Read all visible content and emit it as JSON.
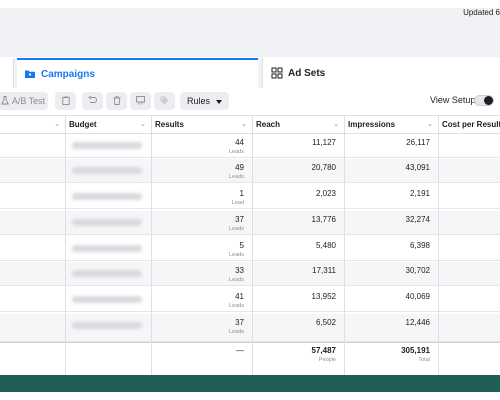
{
  "header": {
    "updated_text": "Updated 6"
  },
  "tabs": [
    {
      "label": "Campaigns",
      "icon": "folder-icon",
      "active": true
    },
    {
      "label": "Ad Sets",
      "icon": "grid-icon",
      "active": false
    }
  ],
  "toolbar": {
    "ab_test_label": "A/B Test",
    "rules_label": "Rules",
    "view_setup_label": "View Setup",
    "view_setup_on": true
  },
  "table": {
    "columns": [
      "Budget",
      "Results",
      "Reach",
      "Impressions",
      "Cost per Result"
    ],
    "rows": [
      {
        "results": "44",
        "results_sub": "Leads",
        "reach": "11,127",
        "impressions": "26,117"
      },
      {
        "results": "49",
        "results_sub": "Leads",
        "reach": "20,780",
        "impressions": "43,091"
      },
      {
        "results": "1",
        "results_sub": "Lead",
        "reach": "2,023",
        "impressions": "2,191"
      },
      {
        "results": "37",
        "results_sub": "Leads",
        "reach": "13,776",
        "impressions": "32,274"
      },
      {
        "results": "5",
        "results_sub": "Leads",
        "reach": "5,480",
        "impressions": "6,398"
      },
      {
        "results": "33",
        "results_sub": "Leads",
        "reach": "17,311",
        "impressions": "30,702"
      },
      {
        "results": "41",
        "results_sub": "Leads",
        "reach": "13,952",
        "impressions": "40,069"
      },
      {
        "results": "37",
        "results_sub": "Leads",
        "reach": "6,502",
        "impressions": "12,446"
      }
    ],
    "totals": {
      "results": "—",
      "reach": "57,487",
      "reach_sub": "People",
      "impressions": "305,191",
      "impressions_sub": "Total"
    }
  },
  "colors": {
    "accent": "#1877f2",
    "footer": "#215e57"
  }
}
